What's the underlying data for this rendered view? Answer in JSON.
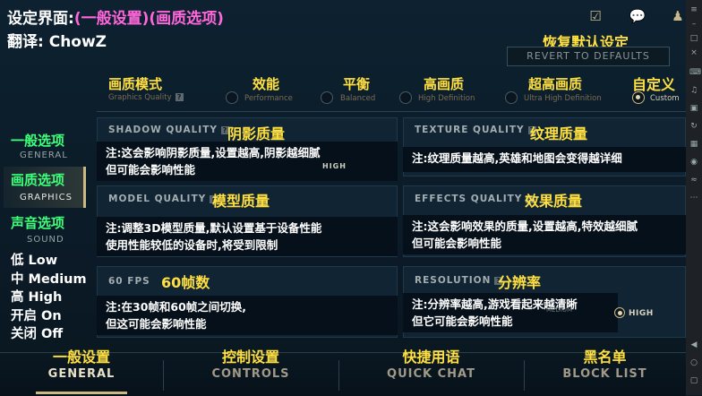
{
  "header": {
    "title_main": "设定界面:",
    "title_sub": "(一般设置)(画质选项)",
    "translator": "翻译: ChowZ"
  },
  "top_icons": [
    "clipboard-check-icon",
    "chat-bubble-icon",
    "friends-icon"
  ],
  "revert": {
    "label_zh": "恢复默认设定",
    "label_en": "REVERT TO DEFAULTS"
  },
  "graphics_quality": {
    "label_zh": "画质模式",
    "label_en": "Graphics Quality",
    "options": [
      {
        "zh": "效能",
        "en": "Performance",
        "selected": false
      },
      {
        "zh": "平衡",
        "en": "Balanced",
        "selected": false
      },
      {
        "zh": "高画质",
        "en": "High Definition",
        "selected": false
      },
      {
        "zh": "超高画质",
        "en": "Ultra High Definition",
        "selected": false
      },
      {
        "zh": "自定义",
        "en": "Custom",
        "selected": true
      }
    ]
  },
  "left_nav": [
    {
      "zh": "一般选项",
      "en": "GENERAL",
      "active": false
    },
    {
      "zh": "画质选项",
      "en": "GRAPHICS",
      "active": true
    },
    {
      "zh": "声音选项",
      "en": "SOUND",
      "active": false
    }
  ],
  "legend": [
    "低 Low",
    "中 Medium",
    "高 High",
    "开启 On",
    "关闭 Off"
  ],
  "settings": {
    "shadow": {
      "en": "SHADOW QUALITY",
      "zh": "阴影质量",
      "note": [
        "注:这会影响阴影质量,设置越高,阴影越细腻",
        "但可能会影响性能"
      ],
      "value": "HIGH"
    },
    "texture": {
      "en": "TEXTURE QUALITY",
      "zh": "纹理质量",
      "note": [
        "注:纹理质量越高,英雄和地图会变得越详细"
      ]
    },
    "model": {
      "en": "MODEL QUALITY",
      "zh": "模型质量",
      "note": [
        "注:调整3D模型质量,默认设置基于设备性能",
        "使用性能较低的设备时,将受到限制"
      ]
    },
    "effects": {
      "en": "EFFECTS QUALITY",
      "zh": "效果质量",
      "note": [
        "注:这会影响效果的质量,设置越高,特效越细腻",
        "但可能会影响性能"
      ]
    },
    "fps": {
      "en": "60 FPS",
      "zh": "60帧数",
      "note": [
        "注:在30帧和60帧之间切换,",
        "但这可能会影响性能"
      ]
    },
    "resolution": {
      "en": "RESOLUTION",
      "zh": "分辨率",
      "note": [
        "注:分辨率越高,游戏看起来越清晰",
        "但它可能会影响性能"
      ],
      "value_left": "MEDIUM",
      "value": "HIGH"
    }
  },
  "bottom_tabs": [
    {
      "zh": "一般设置",
      "en": "GENERAL",
      "active": true
    },
    {
      "zh": "控制设置",
      "en": "CONTROLS",
      "active": false
    },
    {
      "zh": "快捷用语",
      "en": "QUICK CHAT",
      "active": false
    },
    {
      "zh": "黑名单",
      "en": "BLOCK LIST",
      "active": false
    }
  ],
  "colors": {
    "annotation_yellow": "#ffe040",
    "annotation_green": "#3dff7a",
    "annotation_pink": "#ff66d9",
    "gold_accent": "#cbb981",
    "background": "#0b1b27"
  }
}
